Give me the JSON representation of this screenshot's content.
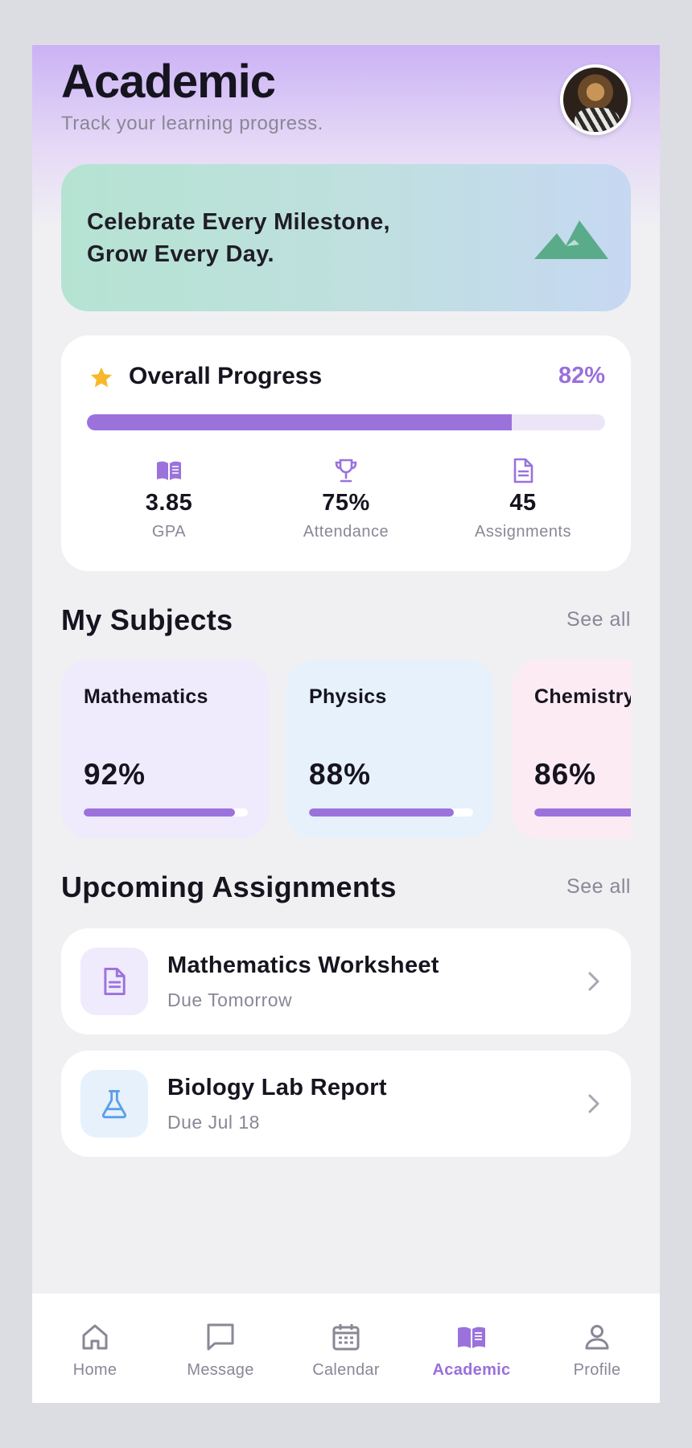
{
  "header": {
    "title": "Academic",
    "subtitle": "Track your learning progress."
  },
  "banner": {
    "line1": "Celebrate Every Milestone,",
    "line2": "Grow Every Day.",
    "icon": "mountain-icon"
  },
  "overall": {
    "title": "Overall Progress",
    "percent_label": "82%",
    "progress_fraction": 0.82,
    "stats": [
      {
        "icon": "book-icon",
        "value": "3.85",
        "label": "GPA"
      },
      {
        "icon": "trophy-icon",
        "value": "75%",
        "label": "Attendance"
      },
      {
        "icon": "document-icon",
        "value": "45",
        "label": "Assignments"
      }
    ]
  },
  "subjects_section": {
    "title": "My Subjects",
    "see_all": "See all",
    "items": [
      {
        "name": "Mathematics",
        "percent": "92%",
        "progress_fraction": 0.92,
        "bg": "#efeafc"
      },
      {
        "name": "Physics",
        "percent": "88%",
        "progress_fraction": 0.88,
        "bg": "#e6f1fc"
      },
      {
        "name": "Chemistry",
        "percent": "86%",
        "progress_fraction": 0.86,
        "bg": "#fdebf3"
      }
    ]
  },
  "assignments_section": {
    "title": "Upcoming Assignments",
    "see_all": "See all",
    "items": [
      {
        "title": "Mathematics Worksheet",
        "due": "Due Tomorrow",
        "icon": "document-icon"
      },
      {
        "title": "Biology Lab Report",
        "due": "Due Jul 18",
        "icon": "flask-icon"
      }
    ]
  },
  "nav": {
    "items": [
      {
        "label": "Home",
        "icon": "home-icon"
      },
      {
        "label": "Message",
        "icon": "message-icon"
      },
      {
        "label": "Calendar",
        "icon": "calendar-icon"
      },
      {
        "label": "Academic",
        "icon": "book-icon",
        "active": true
      },
      {
        "label": "Profile",
        "icon": "profile-icon"
      }
    ]
  },
  "colors": {
    "accent": "#9b72dc",
    "accent_text": "#9b6fdc",
    "star": "#f7b92b",
    "mountain": "#5aab8a",
    "muted": "#8a8796",
    "physics_icon": "#5b9fe8"
  }
}
